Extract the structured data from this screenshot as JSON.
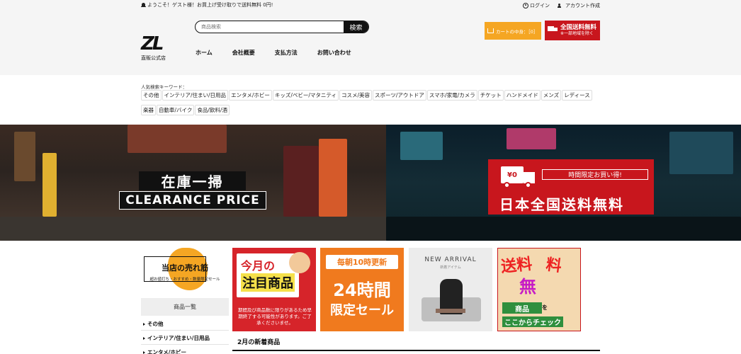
{
  "header": {
    "welcome": "ようこそ！ゲスト様！お買上げ受け取りで送料無料 0円!",
    "login": "ログイン",
    "signup": "アカウント作成",
    "logo_text": "ZL",
    "logo_sub": "直販公式店",
    "search_placeholder": "商品検索",
    "search_button": "検索",
    "nav": [
      "ホーム",
      "会社概要",
      "支払方法",
      "お問い合わせ"
    ],
    "cart_label": "カートの中身：［0］",
    "ship_big": "全国送料無料",
    "ship_small": "※一部地域を除く"
  },
  "keywords": {
    "label": "人気検索キーワード：",
    "row1": [
      "その他",
      "インテリア/住まい/日用品",
      "エンタメ/ホビー",
      "キッズ/ベビー/マタニティ",
      "コスメ/美容",
      "スポーツ/アウトドア",
      "スマホ/家電/カメラ",
      "チケット",
      "ハンドメイド",
      "メンズ",
      "レディース"
    ],
    "row2": [
      "楽器",
      "自動車/バイク",
      "食品/飲料/酒"
    ]
  },
  "banner": {
    "left_top": "在庫一掃",
    "left_bottom": "CLEARANCE PRICE",
    "right_truck": "¥0",
    "right_tag": "時間限定お買い得!",
    "right_main": "日本全国送料無料"
  },
  "sidebar": {
    "bestseller_title": "当店の売れ筋",
    "bestseller_sub": "超お値打ち・おすすめ・数量限定セール",
    "category_head": "商品一覧",
    "categories": [
      "その他",
      "インテリア/住まい/日用品",
      "エンタメ/ホビー"
    ]
  },
  "cards": {
    "c1_a": "今月の",
    "c1_b": "注目商品",
    "c1_text": "期間及び商品数に限りがあるため早期終了する可能性があります。ご了承くださいませ。",
    "c2_tag": "毎朝10時更新",
    "c2_main": "24時間",
    "c2_sub": "限定セール",
    "c3_title": "NEW ARRIVAL",
    "c3_sub": "新着アイテム",
    "c4_a": "送料",
    "c4_b": "料",
    "c4_c": "無",
    "c4_d": "商品",
    "c4_d2": "を",
    "c4_e": "ここからチェック"
  },
  "main": {
    "new_arrivals": "2月の新着商品"
  },
  "colors": {
    "orange": "#f5a623",
    "red": "#c8161d"
  }
}
